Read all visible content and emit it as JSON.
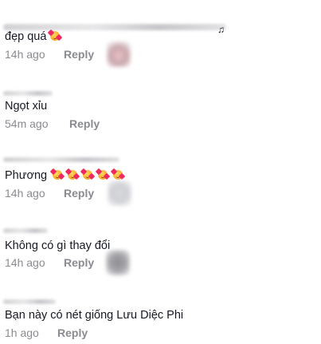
{
  "comments": [
    {
      "username_hidden": true,
      "text": "đẹp quá",
      "emoji_count": 1,
      "time": "14h ago",
      "reply_label": "Reply"
    },
    {
      "username_hidden": true,
      "text": "Ngọt xỉu",
      "emoji_count": 0,
      "time": "54m ago",
      "reply_label": "Reply"
    },
    {
      "username_hidden": true,
      "text": "Phương",
      "emoji_count": 5,
      "time": "14h ago",
      "reply_label": "Reply"
    },
    {
      "username_hidden": true,
      "text": "Không có gì thay đổi",
      "emoji_count": 0,
      "time": "14h ago",
      "reply_label": "Reply"
    },
    {
      "username_hidden": true,
      "text": "Bạn này có nét giống Lưu Diệc Phi",
      "emoji_count": 0,
      "time": "1h ago",
      "reply_label": "Reply"
    }
  ],
  "icons": {
    "emoji": "smiling-face-with-hearts-icon",
    "music": "music-note-icon"
  },
  "colors": {
    "text": "#161823",
    "secondary": "#8a8b91",
    "emoji_heart": "#f02860"
  }
}
